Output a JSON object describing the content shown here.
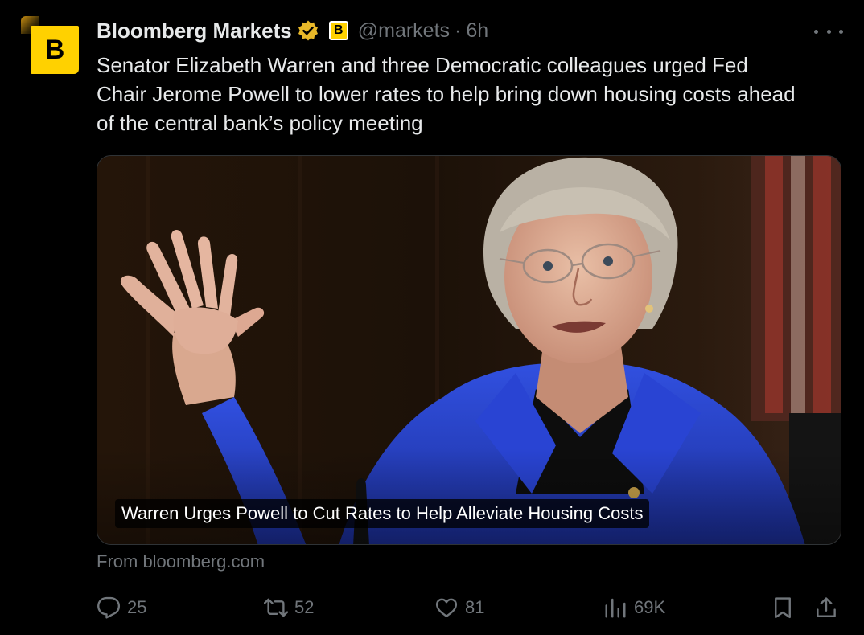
{
  "author": {
    "avatar_letter": "B",
    "name": "Bloomberg Markets",
    "affiliate_badge": "B",
    "handle": "@markets",
    "separator": "·",
    "time": "6h"
  },
  "tweet": {
    "text": "Senator Elizabeth Warren and three Democratic colleagues urged Fed\nChair Jerome Powell to lower rates to help bring down housing costs ahead\nof the central bank’s policy meeting"
  },
  "card": {
    "caption": "Warren Urges Powell to Cut Rates to Help Alleviate Housing Costs",
    "source": "From bloomberg.com"
  },
  "actions": {
    "replies": "25",
    "reposts": "52",
    "likes": "81",
    "views": "69K"
  },
  "colors": {
    "background": "#000000",
    "text": "#e7e9ea",
    "muted": "#71767b",
    "brand_yellow": "#ffd100",
    "verified_gold": "#e8b829",
    "jacket_blue": "#2a45d6"
  },
  "icons": [
    "verified-badge-icon",
    "more-icon",
    "reply-icon",
    "repost-icon",
    "like-icon",
    "views-icon",
    "bookmark-icon",
    "share-icon"
  ]
}
